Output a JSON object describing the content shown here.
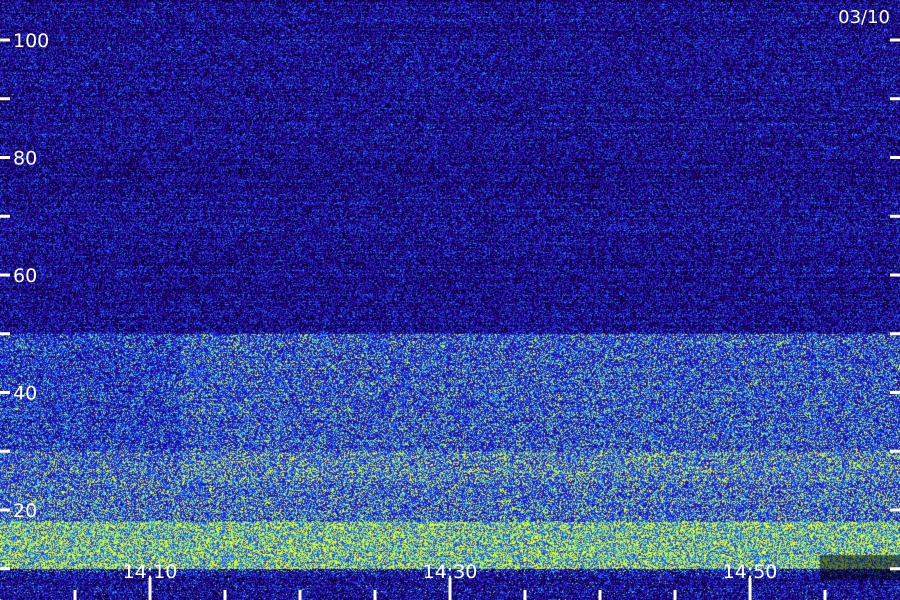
{
  "chart_data": {
    "type": "heatmap",
    "title": "",
    "date_label": "03/10",
    "xlabel": "",
    "ylabel": "",
    "x_ticks": [
      {
        "label": "14:10",
        "value": "14:10"
      },
      {
        "label": "14:30",
        "value": "14:30"
      },
      {
        "label": "14:50",
        "value": "14:50"
      }
    ],
    "x_minor_tick_step_minutes": 5,
    "x_range": [
      "14:05",
      "14:55"
    ],
    "y_ticks": [
      {
        "label": "100",
        "value": 100
      },
      {
        "label": "80",
        "value": 80
      },
      {
        "label": "60",
        "value": 60
      },
      {
        "label": "40",
        "value": 40
      },
      {
        "label": "20",
        "value": 20
      }
    ],
    "y_minor_ticks": [
      90,
      70,
      50,
      30,
      10
    ],
    "ylim": [
      10,
      110
    ],
    "grid": false,
    "colormap": [
      "#000000",
      "#1a0060",
      "#2a10d0",
      "#2050ff",
      "#20c0ff",
      "#a0ff40",
      "#ffff00"
    ],
    "intensity_bands": [
      {
        "y_range": [
          50,
          110
        ],
        "level": 0.15
      },
      {
        "y_range": [
          30,
          50
        ],
        "level": 0.35
      },
      {
        "y_range": [
          18,
          30
        ],
        "level": 0.5
      },
      {
        "y_range": [
          10,
          18
        ],
        "level": 0.75
      }
    ]
  },
  "colors": {
    "background": "#000000",
    "axis": "#ffffff"
  }
}
